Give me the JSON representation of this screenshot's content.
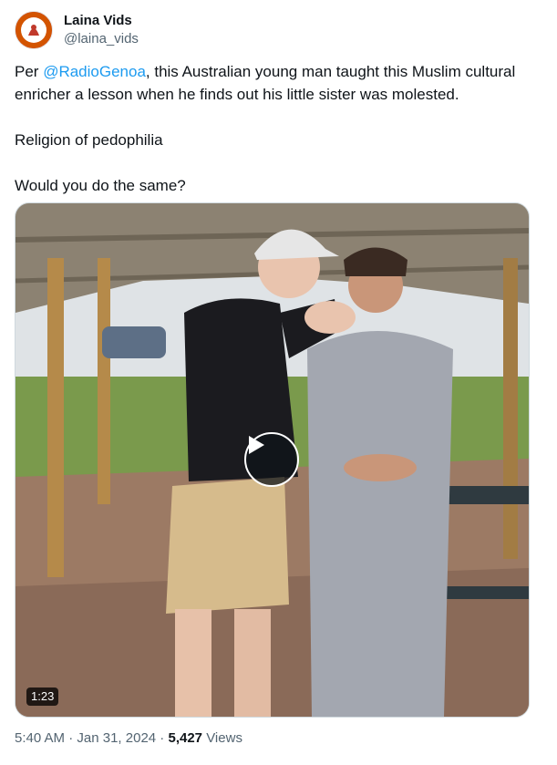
{
  "author": {
    "display_name": "Laina Vids",
    "handle": "@laina_vids",
    "avatar_icon": "avatar-logo"
  },
  "tweet": {
    "line1_prefix": "Per ",
    "mention": "@RadioGenoa",
    "line1_suffix": ", this Australian young man taught this Muslim cultural enricher a lesson when he finds out his little sister was molested.",
    "paragraph2": "Religion of pedophilia",
    "paragraph3": "Would you do the same?"
  },
  "media": {
    "duration": "1:23",
    "play_icon": "play-icon"
  },
  "meta": {
    "time": "5:40 AM",
    "sep1": " · ",
    "date": "Jan 31, 2024",
    "sep2": " · ",
    "views_count": "5,427",
    "views_label": " Views"
  },
  "colors": {
    "link": "#1d9bf0",
    "secondary_text": "#536471",
    "primary_text": "#0f1419"
  }
}
